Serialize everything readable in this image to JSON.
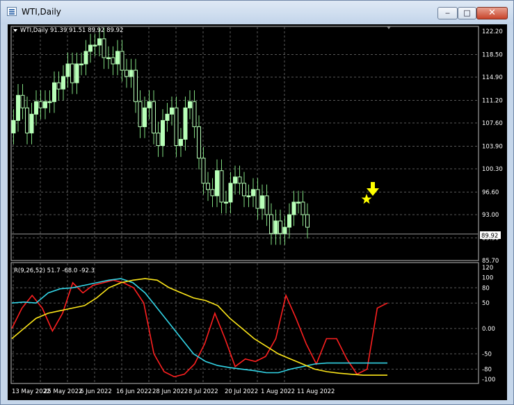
{
  "window": {
    "title": "WTI,Daily",
    "minimize": "‒",
    "maximize": "□",
    "close": "✕"
  },
  "main_pane": {
    "header": "WTI,Daily  91.39 91.51 89.92 89.92",
    "current_price": "89.92",
    "price_ticks": [
      "122.20",
      "118.50",
      "114.90",
      "111.20",
      "107.60",
      "103.90",
      "100.30",
      "96.60",
      "93.00",
      "89.30",
      "85.70"
    ]
  },
  "indicator_pane": {
    "header": "R(9,26,52) 51.7 -68.0 -92.3",
    "ticks": [
      "120",
      "100",
      "80",
      "50",
      "0.00",
      "-50",
      "-80",
      "-100"
    ]
  },
  "date_labels": [
    "13 May 2022",
    "25 May 2022",
    "6 Jun 2022",
    "16 Jun 2022",
    "28 Jun 2022",
    "8 Jul 2022",
    "20 Jul 2022",
    "1 Aug 2022",
    "11 Aug 2022"
  ],
  "colors": {
    "background": "#000000",
    "grid": "#5a5a5a",
    "bull_candle": "#b8ffb8",
    "bear_candle": "#000000",
    "candle_wick": "#7fdc7f",
    "signal_arrow": "#ffff00",
    "fast_line": "#ff2020",
    "medium_line": "#33d6e8",
    "slow_line": "#ffe81a"
  },
  "markers": {
    "arrow_icon": "down-arrow-icon",
    "star_icon": "star-icon"
  }
}
